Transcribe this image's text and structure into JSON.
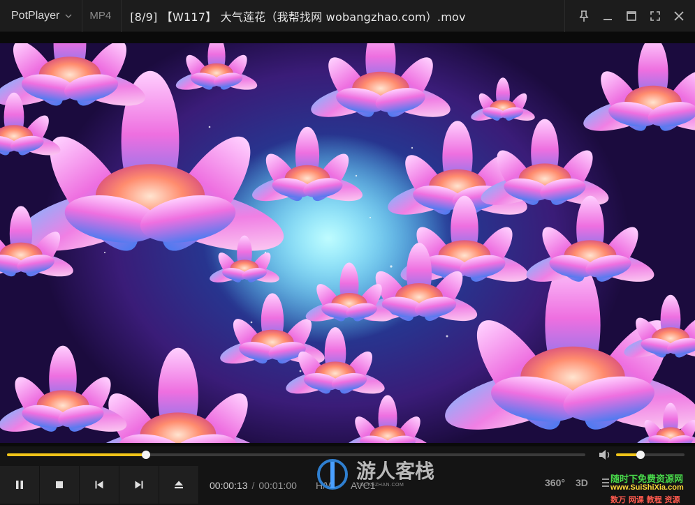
{
  "app": {
    "name": "PotPlayer",
    "format": "MP4",
    "file_title": "[8/9] 【W117】 大气莲花（我帮找网 wobangzhao.com）.mov"
  },
  "window": {
    "controls": [
      "pin-icon",
      "minimize-icon",
      "maximize-icon",
      "fullscreen-icon",
      "close-icon"
    ]
  },
  "playback": {
    "current_time": "00:00:13",
    "separator": "/",
    "duration": "00:01:00",
    "progress": 0.24,
    "volume": 0.36,
    "codec_hw": "H/W",
    "codec_video": "AVC1",
    "buttons": [
      "pause-icon",
      "stop-icon",
      "previous-icon",
      "next-icon",
      "eject-icon"
    ],
    "vr_label": "360°",
    "three_d_label": "3D"
  },
  "watermarks": {
    "center_cn": "游人客栈",
    "center_url": "YOUKEZHAN.COM",
    "corner_cn": "随时下免费资源网",
    "corner_url": "www.SuiShiXia.com",
    "corner_sub": "数万 网课 教程 资源"
  },
  "colors": {
    "accent": "#f0c419",
    "titlebar_bg": "#1c1c1c",
    "controls_bg": "#141414",
    "button_bg": "#1f1f1f"
  }
}
